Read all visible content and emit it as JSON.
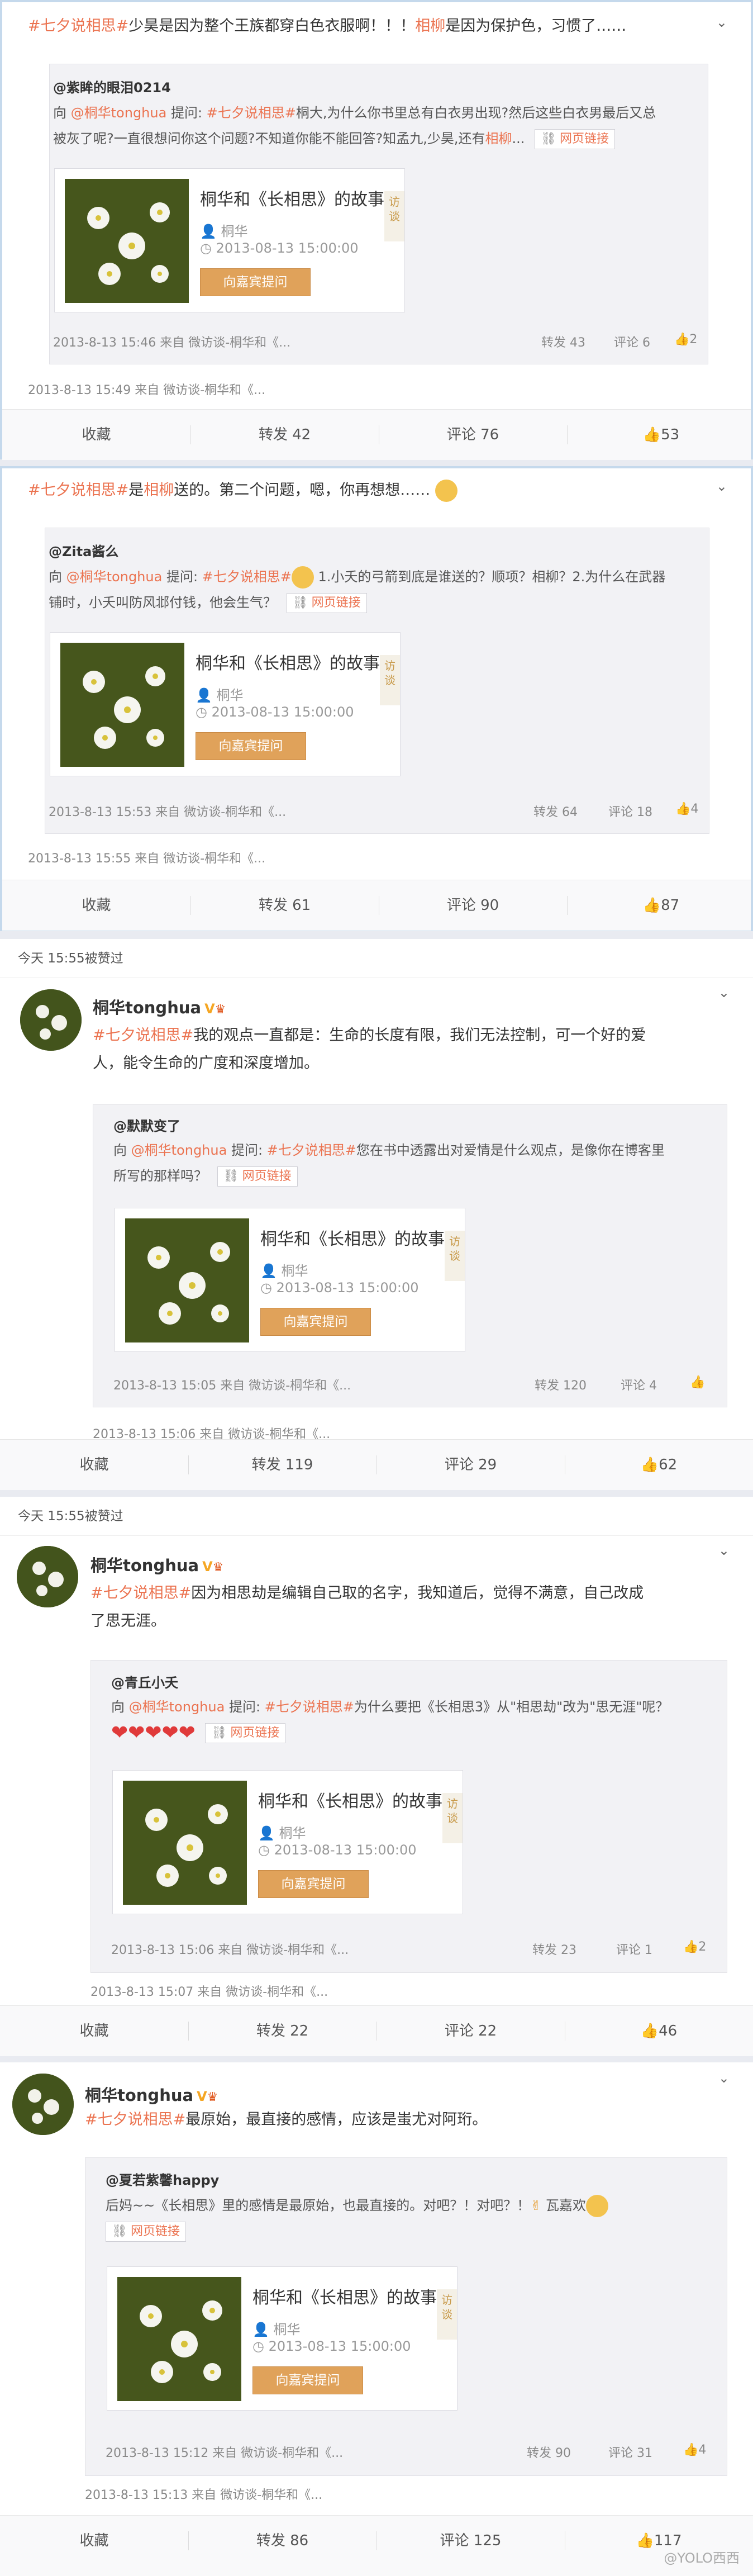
{
  "common": {
    "weblink": "网页链接",
    "media_title": "桐华和《长相思》的故事",
    "media_author": "桐华",
    "media_time": "2013-08-13 15:00:00",
    "media_button": "向嘉宾提问",
    "media_side": "访谈",
    "collect": "收藏",
    "forward_label": "转发",
    "comment_label": "评论"
  },
  "posts": [
    {
      "tag": "#七夕说相思#",
      "text_pre": "少昊是因为整个王族都穿白色衣服啊！！！",
      "mention": "相柳",
      "text_post": "是因为保护色，习惯了……",
      "q_author": "@紫眸的眼泪0214",
      "q_line1_pre": "向 ",
      "q_at": "@桐华tonghua",
      "q_ask": " 提问: ",
      "q_tag": "#七夕说相思#",
      "q_line1_post": "桐大,为什么你书里总有白衣男出现?然后这些白衣男最后又总",
      "q_line2_pre": "被灰了呢?一直很想问你这个问题?不知道你能不能回答?知孟九,少昊,还有",
      "q_line2_mention": "相柳",
      "q_line2_post": "...",
      "inner_meta": "2013-8-13 15:46 来自 微访谈-桐华和《...",
      "inner_forward": "转发 43",
      "inner_comment": "评论 6",
      "inner_like": "2",
      "meta": "2013-8-13 15:49 来自 微访谈-桐华和《...",
      "forward": "转发 42",
      "comment": "评论 76",
      "like": "53"
    },
    {
      "tag": "#七夕说相思#",
      "text_pre": "是",
      "mention": "相柳",
      "text_post": "送的。第二个问题，嗯，你再想想……",
      "q_author": "@Zita酱么",
      "q_line1_pre": "向 ",
      "q_at": "@桐华tonghua",
      "q_ask": " 提问: ",
      "q_tag": "#七夕说相思#",
      "q_line1_post": " 1.小夭的弓箭到底是谁送的？顺项？相柳？2.为什么在武器",
      "q_line2_pre": "铺时，小夭叫防风邶付钱，他会生气？",
      "inner_meta": "2013-8-13 15:53 来自 微访谈-桐华和《...",
      "inner_forward": "转发 64",
      "inner_comment": "评论 18",
      "inner_like": "4",
      "meta": "2013-8-13 15:55 来自 微访谈-桐华和《...",
      "forward": "转发 61",
      "comment": "评论 90",
      "like": "87"
    },
    {
      "subhead": "今天 15:55被赞过",
      "user": "桐华tonghua",
      "tag": "#七夕说相思#",
      "text_line1": "我的观点一直都是：生命的长度有限，我们无法控制，可一个好的爱",
      "text_line2": "人，能令生命的广度和深度增加。",
      "q_author": "@默默变了",
      "q_line1_pre": "向 ",
      "q_at": "@桐华tonghua",
      "q_ask": " 提问: ",
      "q_tag": "#七夕说相思#",
      "q_line1_post": "您在书中透露出对爱情是什么观点，是像你在博客里",
      "q_line2_pre": "所写的那样吗？",
      "inner_meta": "2013-8-13 15:05 来自 微访谈-桐华和《...",
      "inner_forward": "转发 120",
      "inner_comment": "评论 4",
      "inner_like": "",
      "meta": "2013-8-13 15:06 来自 微访谈-桐华和《...",
      "forward": "转发 119",
      "comment": "评论 29",
      "like": "62"
    },
    {
      "subhead": "今天 15:55被赞过",
      "user": "桐华tonghua",
      "tag": "#七夕说相思#",
      "text_line1": "因为相思劫是编辑自己取的名字，我知道后，觉得不满意，自己改成",
      "text_line2": "了思无涯。",
      "q_author": "@青丘小夭",
      "q_line1_pre": "向 ",
      "q_at": "@桐华tonghua",
      "q_ask": " 提问: ",
      "q_tag": "#七夕说相思#",
      "q_line1_post": "为什么要把《长相思3》从\"相思劫\"改为\"思无涯\"呢？",
      "inner_meta": "2013-8-13 15:06 来自 微访谈-桐华和《...",
      "inner_forward": "转发 23",
      "inner_comment": "评论 1",
      "inner_like": "2",
      "meta": "2013-8-13 15:07 来自 微访谈-桐华和《...",
      "forward": "转发 22",
      "comment": "评论 22",
      "like": "46"
    },
    {
      "user": "桐华tonghua",
      "tag": "#七夕说相思#",
      "text_line1": "最原始，最直接的感情，应该是蚩尤对阿珩。",
      "q_author": "@夏若紫馨happy",
      "q_line1": "后妈~~《长相思》里的感情是最原始，也最直接的。对吧？！对吧？！",
      "q_line1_tail": "瓦嘉欢",
      "inner_meta": "2013-8-13 15:12 来自 微访谈-桐华和《...",
      "inner_forward": "转发 90",
      "inner_comment": "评论 31",
      "inner_like": "4",
      "meta": "2013-8-13 15:13 来自 微访谈-桐华和《...",
      "forward": "转发 86",
      "comment": "评论 125",
      "like": "117"
    }
  ],
  "watermark": "@YOLO西西"
}
